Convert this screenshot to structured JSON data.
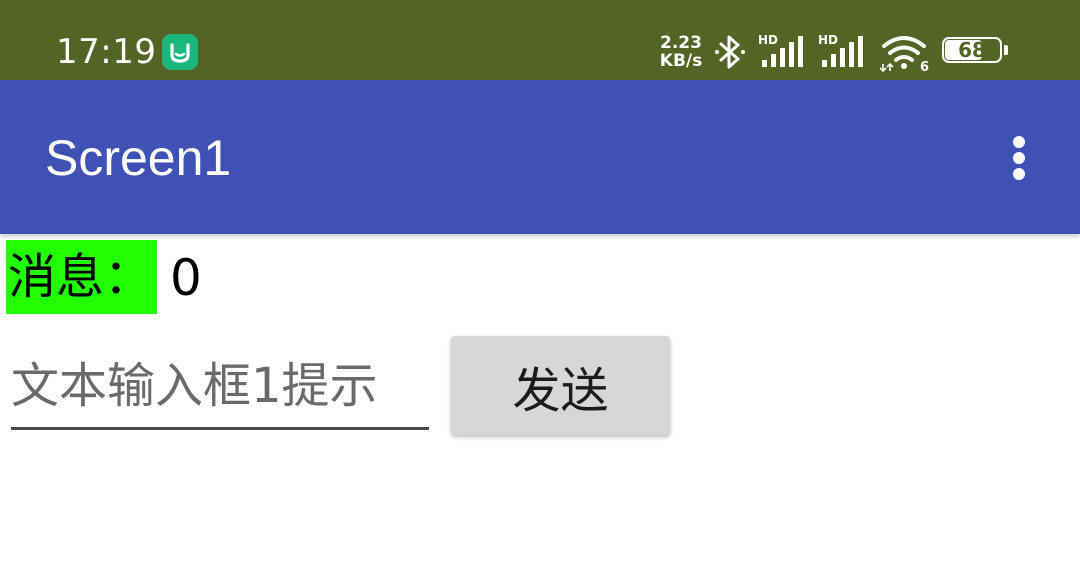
{
  "status_bar": {
    "time": "17:19",
    "app_icon": "mi-home-icon",
    "net_speed_value": "2.23",
    "net_speed_unit": "KB/s",
    "bluetooth_icon": "bluetooth-icon",
    "signal_1_badge": "HD",
    "signal_2_badge": "HD",
    "wifi_badge": "6",
    "battery_level": "68",
    "battery_fraction": 0.68,
    "background_color": "#546425"
  },
  "app_bar": {
    "title": "Screen1",
    "menu_icon": "more-vert-icon",
    "background_color": "#3f51b5"
  },
  "content": {
    "message_label": "消息：",
    "message_label_bg": "#22ff00",
    "message_value": "0",
    "text_input": {
      "placeholder": "文本输入框1提示",
      "value": ""
    },
    "send_button_label": "发送",
    "send_button_bg": "#d6d7d7"
  }
}
